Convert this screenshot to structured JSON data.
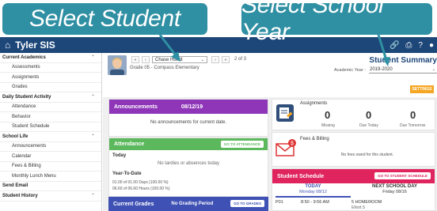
{
  "callouts": {
    "select_student": "Select Student",
    "select_year": "Select School Year"
  },
  "app": {
    "name": "Tyler SIS"
  },
  "sidebar": {
    "sections": [
      {
        "label": "Current Academics",
        "items": [
          "Assessments",
          "Assignments",
          "Grades"
        ]
      },
      {
        "label": "Daily Student Activity",
        "items": [
          "Attendance",
          "Behavior",
          "Student Schedule"
        ]
      },
      {
        "label": "School Life",
        "items": [
          "Announcements",
          "Calendar",
          "Fees & Billing",
          "Monthly Lunch Menu"
        ]
      },
      {
        "label": "Send Email",
        "items": []
      },
      {
        "label": "Student History",
        "items": []
      }
    ]
  },
  "student": {
    "selected": "Chase Hulett",
    "count": "2 of 3",
    "grade_school": "Grade 05 - Compass Elementary",
    "nav": {
      "first": "«",
      "prev": "‹",
      "next": "›",
      "last": "»"
    }
  },
  "summary": {
    "title": "Student Summary",
    "ay_label": "Academic Year -",
    "ay_value": "2019-2020",
    "settings": "SETTINGS"
  },
  "announcements": {
    "title": "Announcements",
    "date": "08/12/19",
    "empty": "No announcements for current date."
  },
  "attendance": {
    "title": "Attendance",
    "button": "GO TO ATTENDANCE",
    "today_label": "Today",
    "today_text": "No tardies or absences today",
    "ytd_label": "Year-To-Date",
    "line1": "01.00 of 01.00 Days (100.00 %)",
    "line2": "06.60 of 06.60 Hours (100.00 %)"
  },
  "grades": {
    "title": "Current Grades",
    "period": "No Grading Period",
    "button": "GO TO GRADES"
  },
  "assignments": {
    "title": "Assignments",
    "missing": {
      "value": "0",
      "label": "Missing"
    },
    "due_today": {
      "value": "0",
      "label": "Due Today"
    },
    "due_tomorrow": {
      "value": "0",
      "label": "Due Tomorrow"
    }
  },
  "fees": {
    "title": "Fees & Billing",
    "text": "No fees owed for this student."
  },
  "schedule": {
    "title": "Student Schedule",
    "button": "GO TO STUDENT SCHEDULE",
    "today": {
      "label": "TODAY",
      "date": "Monday 08/12"
    },
    "next": {
      "label": "NEXT SCHOOL DAY",
      "date": "Friday 08/16"
    },
    "row": {
      "period": "P01",
      "time": "8:50 - 9:56 AM",
      "course": "5 HOMEROOM",
      "teacher": "Elliott S"
    }
  },
  "colors": {
    "callout": "#2f8fa3",
    "topbar": "#1d4779",
    "announcements": "#8e35b8",
    "attendance": "#5cb85c",
    "grades": "#3f51b5",
    "schedule": "#e0245e",
    "settings": "#f5a623"
  }
}
